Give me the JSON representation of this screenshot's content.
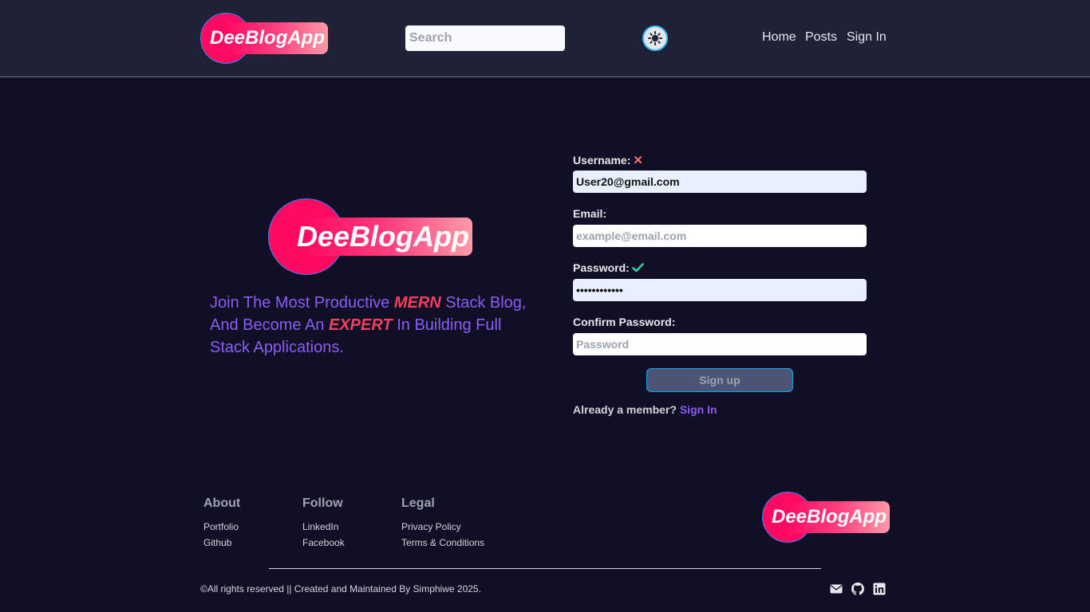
{
  "header": {
    "logo_text": "DeeBlogApp",
    "search_placeholder": "Search",
    "nav": {
      "home": "Home",
      "posts": "Posts",
      "sign_in": "Sign In"
    }
  },
  "hero": {
    "logo_text": "DeeBlogApp",
    "tagline": {
      "part1": "Join The Most Productive ",
      "em1": "MERN",
      "part2": " Stack Blog, And Become An ",
      "em2": "EXPERT",
      "part3": " In Building Full Stack Applications."
    }
  },
  "form": {
    "username_label": "Username:",
    "username_status": "✕",
    "username_value": "User20@gmail.com",
    "email_label": "Email:",
    "email_placeholder": "example@email.com",
    "password_label": "Password:",
    "password_value": "••••••••••••",
    "confirm_label": "Confirm Password:",
    "confirm_placeholder": "Password",
    "signup_label": "Sign up",
    "member_text": "Already a member?",
    "member_link": "Sign In"
  },
  "footer": {
    "about": {
      "heading": "About",
      "links": [
        "Portfolio",
        "Github"
      ]
    },
    "follow": {
      "heading": "Follow",
      "links": [
        "LinkedIn",
        "Facebook"
      ]
    },
    "legal": {
      "heading": "Legal",
      "links": [
        "Privacy Policy",
        "Terms & Conditions"
      ]
    },
    "logo_text": "DeeBlogApp",
    "copyright": "©All rights reserved || Created and Maintained By Simphiwe 2025.",
    "social_icons": [
      "mail-icon",
      "github-icon",
      "linkedin-icon"
    ]
  },
  "colors": {
    "background": "#110f25",
    "header": "#1f2237",
    "brand_pink": "#ff0a63",
    "accent_purple": "#8b5cf6",
    "emphasis_red": "#f43f5e"
  }
}
